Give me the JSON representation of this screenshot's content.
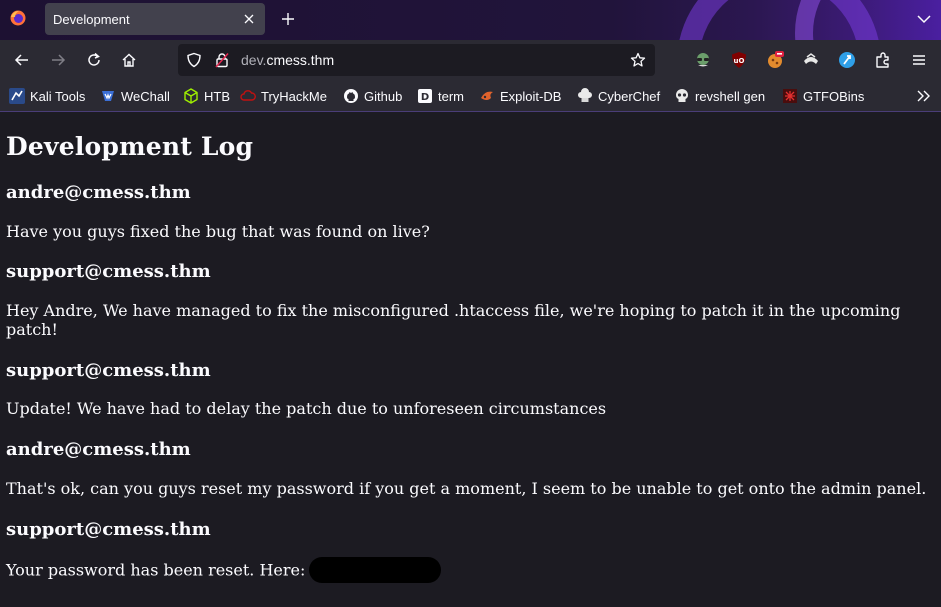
{
  "tab": {
    "title": "Development"
  },
  "url": {
    "subdomain": "dev.",
    "domain": "cmess.thm"
  },
  "bookmarks": [
    {
      "label": "Kali Tools",
      "icon": "kali-dragon-icon"
    },
    {
      "label": "WeChall",
      "icon": "wechall-icon"
    },
    {
      "label": "HTB",
      "icon": "htb-cube-icon"
    },
    {
      "label": "TryHackMe",
      "icon": "tryhackme-cloud-icon"
    },
    {
      "label": "Github",
      "icon": "github-icon"
    },
    {
      "label": "term",
      "icon": "term-icon"
    },
    {
      "label": "Exploit-DB",
      "icon": "exploit-db-icon"
    },
    {
      "label": "CyberChef",
      "icon": "cyberchef-hat-icon"
    },
    {
      "label": "revshell gen",
      "icon": "skull-icon"
    },
    {
      "label": "GTFOBins",
      "icon": "gtfobins-icon"
    }
  ],
  "page": {
    "title": "Development Log",
    "entries": [
      {
        "author": "andre@cmess.thm",
        "message": "Have you guys fixed the bug that was found on live?"
      },
      {
        "author": "support@cmess.thm",
        "message": "Hey Andre, We have managed to fix the misconfigured .htaccess file, we're hoping to patch it in the upcoming patch!"
      },
      {
        "author": "support@cmess.thm",
        "message": "Update! We have had to delay the patch due to unforeseen circumstances"
      },
      {
        "author": "andre@cmess.thm",
        "message": "That's ok, can you guys reset my password if you get a moment, I seem to be unable to get onto the admin panel."
      },
      {
        "author": "support@cmess.thm",
        "message": "Your password has been reset. Here:"
      }
    ]
  },
  "colors": {
    "toolbar": "#2b2a33",
    "tab_active": "#42414d",
    "page_bg": "#1c1b22",
    "text": "#fbfbfe"
  }
}
